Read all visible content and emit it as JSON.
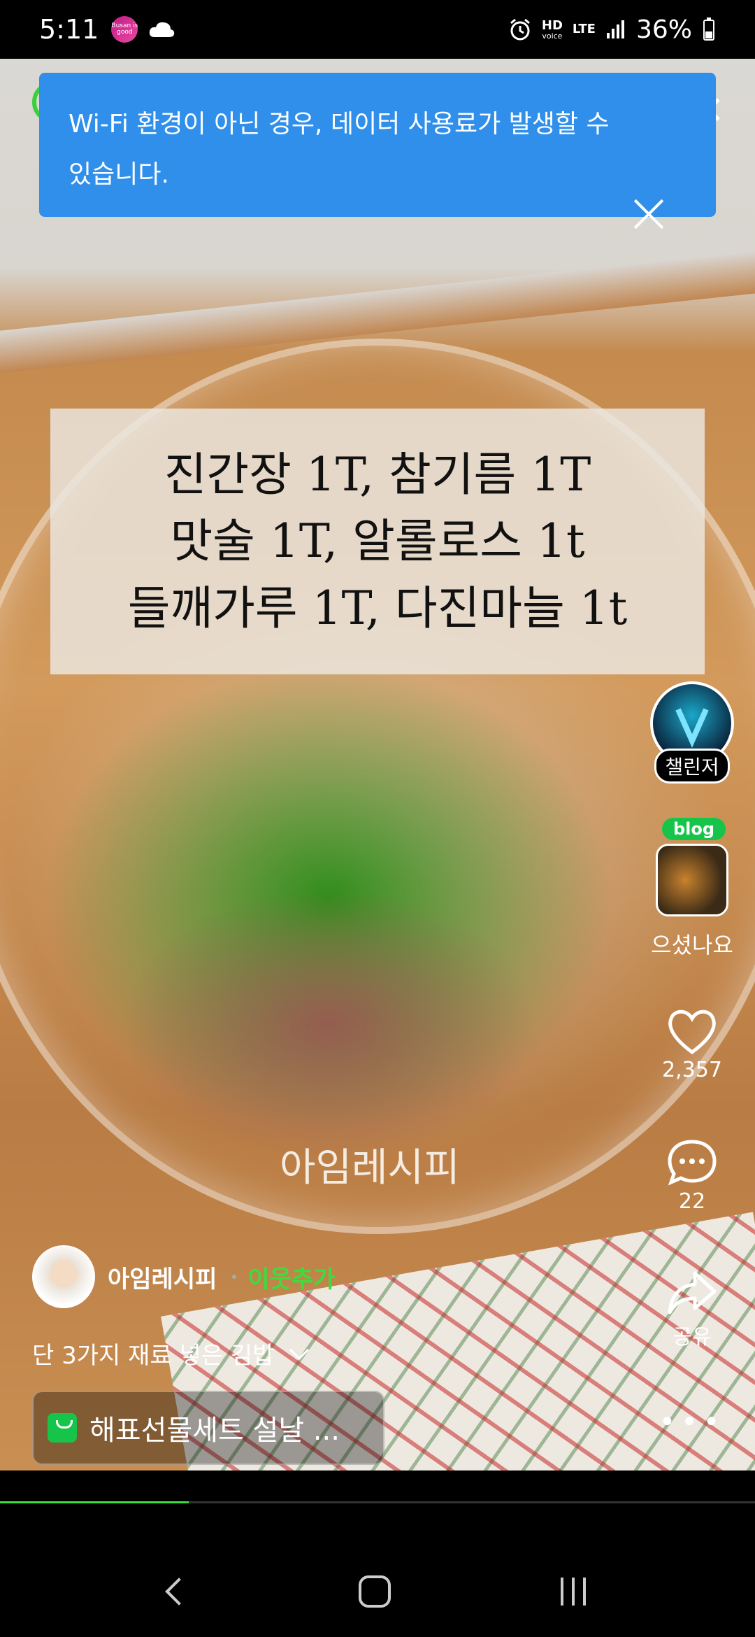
{
  "status_bar": {
    "time": "5:11",
    "badge": "Busan is good",
    "network": "HD",
    "network_sub": "voice",
    "lte": "LTE",
    "battery": "36%"
  },
  "toast": {
    "message": "Wi-Fi 환경이 아닌 경우, 데이터 사용료가 발생할 수 있습니다."
  },
  "video": {
    "overlay_lines": [
      "진간장 1T, 참기름 1T",
      "맛술 1T, 알롤로스 1t",
      "들깨가루 1T, 다진마늘 1t"
    ],
    "watermark": "아임레시피"
  },
  "rail": {
    "challenger_label": "챌린저",
    "blog_tag": "blog",
    "blog_caption": "으셨나요",
    "like_count": "2,357",
    "comment_count": "22",
    "share_label": "공유",
    "more_label": "•••"
  },
  "author": {
    "name": "아임레시피",
    "follow_label": "이웃추가"
  },
  "description": "단 3가지 재료 넣은 김밥",
  "product": {
    "label": "해표선물세트 설날 ..."
  },
  "progress": {
    "fraction": 0.25
  },
  "colors": {
    "accent": "#3ddc3d",
    "toast": "#2f8fea"
  }
}
